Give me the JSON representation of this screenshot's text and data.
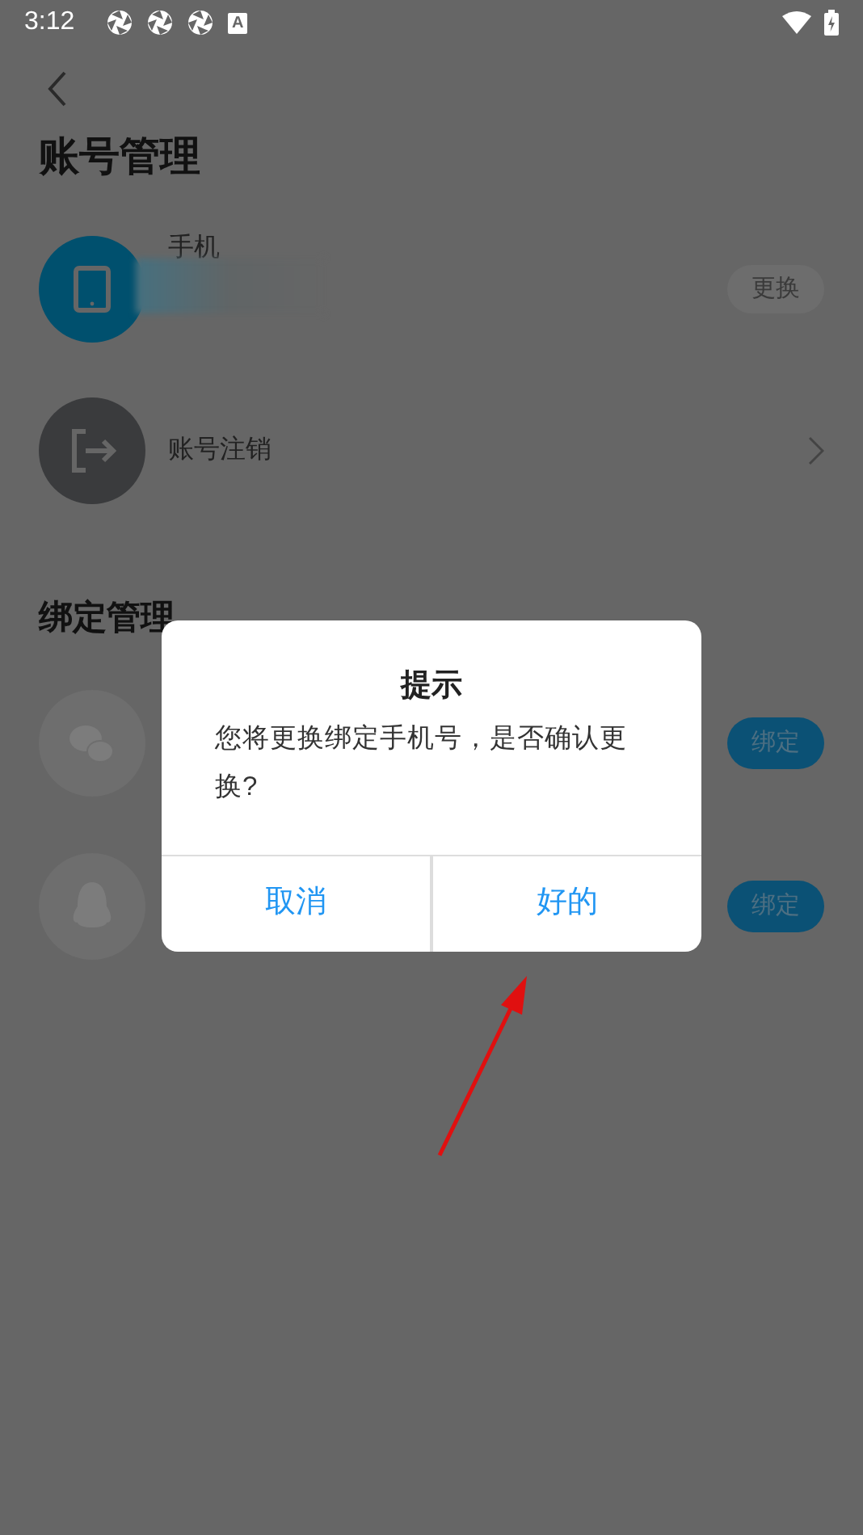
{
  "status_bar": {
    "time": "3:12",
    "badge": "A"
  },
  "page": {
    "title": "账号管理",
    "account_items": [
      {
        "kind": "phone",
        "label": "手机",
        "action": "更换"
      },
      {
        "kind": "logout",
        "label": "账号注销"
      }
    ],
    "binding_section": {
      "title": "绑定管理",
      "items": [
        {
          "kind": "wechat",
          "action": "绑定"
        },
        {
          "kind": "qq",
          "action": "绑定"
        }
      ]
    }
  },
  "dialog": {
    "title": "提示",
    "message": "您将更换绑定手机号，是否确认更换?",
    "buttons": [
      "取消",
      "好的"
    ]
  }
}
